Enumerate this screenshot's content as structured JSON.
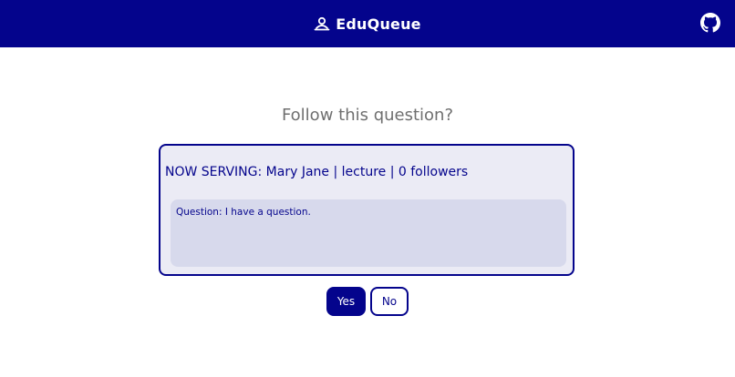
{
  "header": {
    "brand_name": "EduQueue",
    "brand_icon": "queue-logo-icon",
    "github_icon": "github-icon",
    "background_color": "#04048c"
  },
  "dialog": {
    "title": "Follow this question?",
    "serving_text": "NOW SERVING: Mary Jane | lecture | 0 followers",
    "question_text": "Question: I have a question."
  },
  "actions": {
    "yes_label": "Yes",
    "no_label": "No"
  },
  "colors": {
    "accent": "#04048c",
    "card_bg": "#ebebf5",
    "question_bg": "#d7d9ec",
    "title": "#6f6f6f"
  }
}
